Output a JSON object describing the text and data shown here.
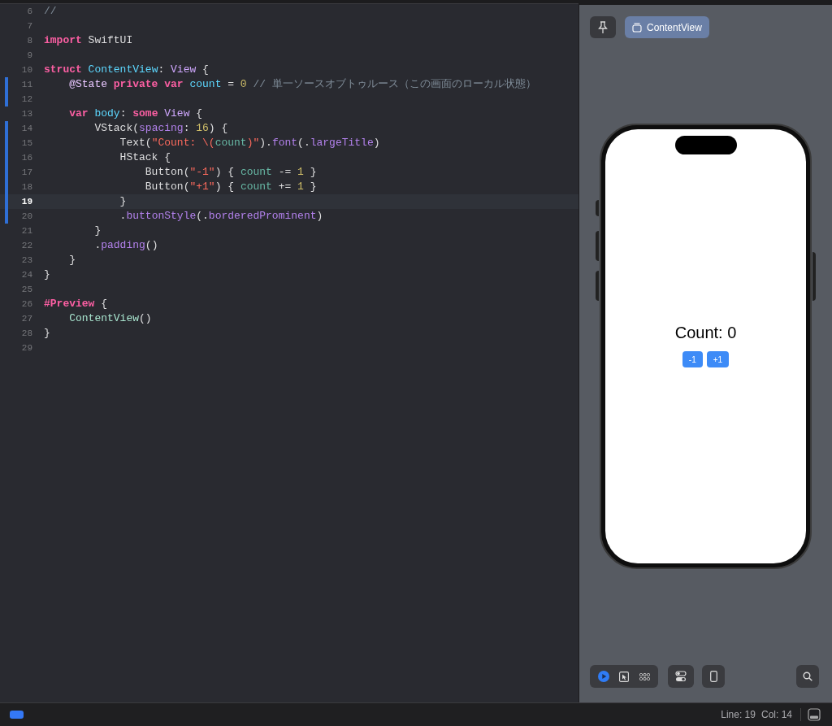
{
  "editor": {
    "lines": [
      {
        "number": "6",
        "changed": false,
        "current": false,
        "tokens": [
          {
            "text": "//",
            "kind": "comment"
          }
        ]
      },
      {
        "number": "7",
        "changed": false,
        "current": false
      },
      {
        "number": "8",
        "changed": false,
        "current": false,
        "tokens": [
          {
            "text": "import",
            "kind": "keyword"
          },
          {
            "text": " SwiftUI",
            "kind": "plain"
          }
        ]
      },
      {
        "number": "9",
        "changed": false,
        "current": false
      },
      {
        "number": "10",
        "changed": false,
        "current": false,
        "tokens": [
          {
            "text": "struct",
            "kind": "keyword"
          },
          {
            "text": " ContentView",
            "kind": "decl"
          },
          {
            "text": ": ",
            "kind": "plain"
          },
          {
            "text": "View",
            "kind": "type"
          },
          {
            "text": " {",
            "kind": "plain"
          }
        ]
      },
      {
        "number": "11",
        "changed": true,
        "current": false,
        "tokens": [
          {
            "text": "    @State",
            "kind": "attr"
          },
          {
            "text": " private var",
            "kind": "keyword"
          },
          {
            "text": " count",
            "kind": "decl"
          },
          {
            "text": " = ",
            "kind": "plain"
          },
          {
            "text": "0",
            "kind": "number"
          },
          {
            "text": " // 単一ソースオブトゥルース（この画面のローカル状態）",
            "kind": "comment"
          }
        ]
      },
      {
        "number": "12",
        "changed": true,
        "current": false
      },
      {
        "number": "13",
        "changed": false,
        "current": false,
        "tokens": [
          {
            "text": "    var",
            "kind": "keyword"
          },
          {
            "text": " body",
            "kind": "decl"
          },
          {
            "text": ": ",
            "kind": "plain"
          },
          {
            "text": "some",
            "kind": "keyword"
          },
          {
            "text": " View",
            "kind": "type"
          },
          {
            "text": " {",
            "kind": "plain"
          }
        ]
      },
      {
        "number": "14",
        "changed": true,
        "current": false,
        "tokens": [
          {
            "text": "        VStack(",
            "kind": "plain"
          },
          {
            "text": "spacing",
            "kind": "member"
          },
          {
            "text": ": ",
            "kind": "plain"
          },
          {
            "text": "16",
            "kind": "number"
          },
          {
            "text": ") {",
            "kind": "plain"
          }
        ]
      },
      {
        "number": "15",
        "changed": true,
        "current": false,
        "tokens": [
          {
            "text": "            Text(",
            "kind": "plain"
          },
          {
            "text": "\"Count: \\(",
            "kind": "string"
          },
          {
            "text": "count",
            "kind": "var"
          },
          {
            "text": ")\"",
            "kind": "string"
          },
          {
            "text": ").",
            "kind": "plain"
          },
          {
            "text": "font",
            "kind": "member"
          },
          {
            "text": "(.",
            "kind": "plain"
          },
          {
            "text": "largeTitle",
            "kind": "member"
          },
          {
            "text": ")",
            "kind": "plain"
          }
        ]
      },
      {
        "number": "16",
        "changed": true,
        "current": false,
        "tokens": [
          {
            "text": "            HStack {",
            "kind": "plain"
          }
        ]
      },
      {
        "number": "17",
        "changed": true,
        "current": false,
        "tokens": [
          {
            "text": "                Button(",
            "kind": "plain"
          },
          {
            "text": "\"-1\"",
            "kind": "string"
          },
          {
            "text": ") { ",
            "kind": "plain"
          },
          {
            "text": "count",
            "kind": "var"
          },
          {
            "text": " -= ",
            "kind": "plain"
          },
          {
            "text": "1",
            "kind": "number"
          },
          {
            "text": " }",
            "kind": "plain"
          }
        ]
      },
      {
        "number": "18",
        "changed": true,
        "current": false,
        "tokens": [
          {
            "text": "                Button(",
            "kind": "plain"
          },
          {
            "text": "\"+1\"",
            "kind": "string"
          },
          {
            "text": ") { ",
            "kind": "plain"
          },
          {
            "text": "count",
            "kind": "var"
          },
          {
            "text": " += ",
            "kind": "plain"
          },
          {
            "text": "1",
            "kind": "number"
          },
          {
            "text": " }",
            "kind": "plain"
          }
        ]
      },
      {
        "number": "19",
        "changed": true,
        "current": true,
        "tokens": [
          {
            "text": "            }",
            "kind": "plain"
          }
        ]
      },
      {
        "number": "20",
        "changed": true,
        "current": false,
        "tokens": [
          {
            "text": "            .",
            "kind": "plain"
          },
          {
            "text": "buttonStyle",
            "kind": "member"
          },
          {
            "text": "(.",
            "kind": "plain"
          },
          {
            "text": "borderedProminent",
            "kind": "member"
          },
          {
            "text": ")",
            "kind": "plain"
          }
        ]
      },
      {
        "number": "21",
        "changed": false,
        "current": false,
        "tokens": [
          {
            "text": "        }",
            "kind": "plain"
          }
        ]
      },
      {
        "number": "22",
        "changed": false,
        "current": false,
        "tokens": [
          {
            "text": "        .",
            "kind": "plain"
          },
          {
            "text": "padding",
            "kind": "member"
          },
          {
            "text": "()",
            "kind": "plain"
          }
        ]
      },
      {
        "number": "23",
        "changed": false,
        "current": false,
        "tokens": [
          {
            "text": "    }",
            "kind": "plain"
          }
        ]
      },
      {
        "number": "24",
        "changed": false,
        "current": false,
        "tokens": [
          {
            "text": "}",
            "kind": "plain"
          }
        ]
      },
      {
        "number": "25",
        "changed": false,
        "current": false
      },
      {
        "number": "26",
        "changed": false,
        "current": false,
        "tokens": [
          {
            "text": "#Preview",
            "kind": "keyword"
          },
          {
            "text": " {",
            "kind": "plain"
          }
        ]
      },
      {
        "number": "27",
        "changed": false,
        "current": false,
        "tokens": [
          {
            "text": "    ContentView",
            "kind": "func"
          },
          {
            "text": "()",
            "kind": "plain"
          }
        ]
      },
      {
        "number": "28",
        "changed": false,
        "current": false,
        "tokens": [
          {
            "text": "}",
            "kind": "plain"
          }
        ]
      },
      {
        "number": "29",
        "changed": false,
        "current": false
      }
    ]
  },
  "preview": {
    "chip": {
      "label": "ContentView"
    },
    "device": {
      "title": "Count: 0",
      "buttons": [
        "-1",
        "+1"
      ]
    },
    "modes": [
      {
        "kind": "live",
        "selected": true
      },
      {
        "kind": "select",
        "selected": false
      },
      {
        "kind": "variants",
        "selected": false
      }
    ]
  },
  "status_bar": {
    "line": "Line: 19",
    "col": "Col: 14"
  }
}
